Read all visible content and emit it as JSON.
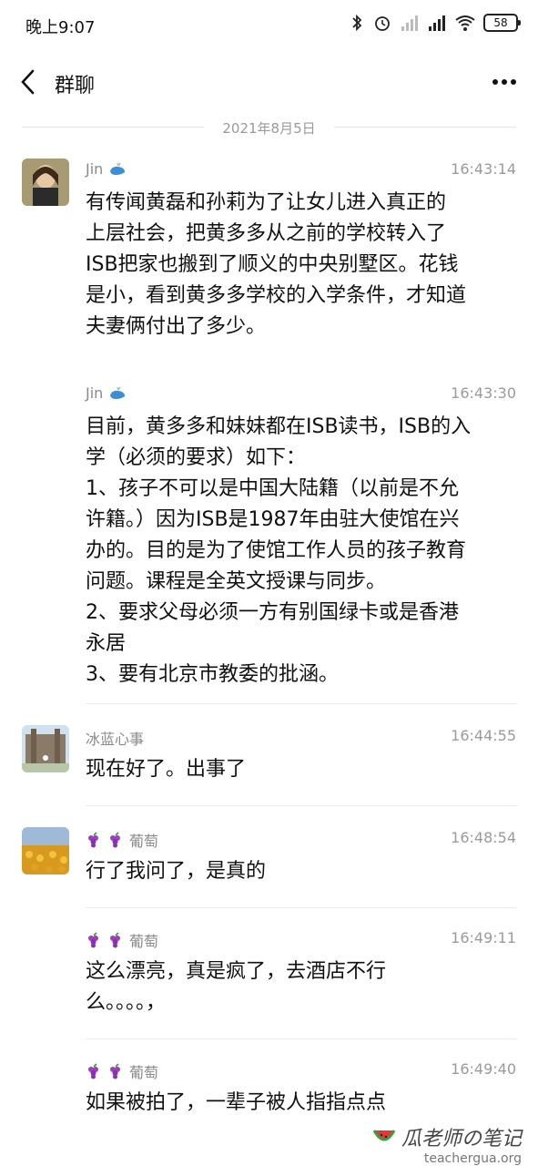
{
  "status": {
    "time": "晚上9:07",
    "battery": "58"
  },
  "header": {
    "title": "群聊"
  },
  "date_divider": "2021年8月5日",
  "messages": [
    {
      "sender": "Jin",
      "time": "16:43:14",
      "text": "有传闻黄磊和孙莉为了让女儿进入真正的\n上层社会，把黄多多从之前的学校转入了\nISB把家也搬到了顺义的中央别墅区。花钱\n是小，看到黄多多学校的入学条件，才知道\n夫妻俩付出了多少。"
    },
    {
      "sender": "Jin",
      "time": "16:43:30",
      "text": "目前，黄多多和妹妹都在ISB读书，ISB的入\n学（必须的要求）如下：\n1、孩子不可以是中国大陆籍（以前是不允\n许籍。）因为ISB是1987年由驻大使馆在兴\n办的。目的是为了使馆工作人员的孩子教育\n问题。课程是全英文授课与同步。\n2、要求父母必须一方有别国绿卡或是香港\n永居\n3、要有北京市教委的批涵。"
    },
    {
      "sender": "冰蓝心事",
      "time": "16:44:55",
      "text": "现在好了。出事了"
    },
    {
      "sender": "葡萄",
      "time": "16:48:54",
      "text": "行了我问了，是真的"
    },
    {
      "sender": "葡萄",
      "time": "16:49:11",
      "text": "这么漂亮，真是疯了，去酒店不行\n么。。。。，"
    },
    {
      "sender": "葡萄",
      "time": "16:49:40",
      "text": "如果被拍了，一辈子被人指指点点"
    }
  ],
  "watermark": {
    "title": "瓜老师の笔记",
    "site": "teachergua.org"
  },
  "icons": {
    "back": "chevron-left-icon",
    "more": "more-dots-icon",
    "grape": "grape-emoji-icon",
    "whale": "whale-emoji-icon"
  }
}
